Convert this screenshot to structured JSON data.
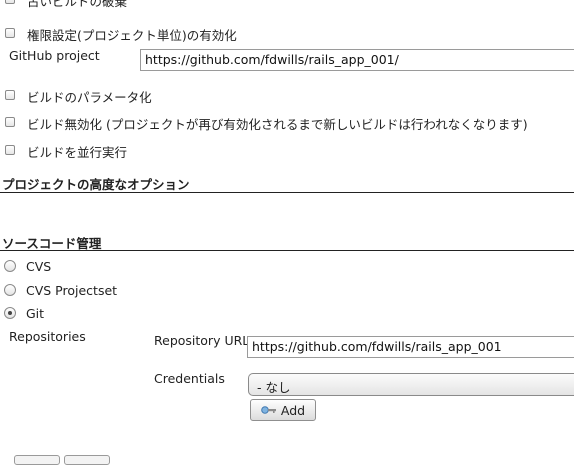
{
  "options": {
    "discard_old_builds": "古いビルドの破棄",
    "enable_project_security": "権限設定(プロジェクト単位)の有効化",
    "github_project_label": "GitHub project",
    "github_project_value": "https://github.com/fdwills/rails_app_001/",
    "parameterized": "ビルドのパラメータ化",
    "disable_build": "ビルド無効化 (プロジェクトが再び有効化されるまで新しいビルドは行われなくなります)",
    "concurrent_build": "ビルドを並行実行"
  },
  "advanced_section_title": "プロジェクトの高度なオプション",
  "scm": {
    "title": "ソースコード管理",
    "options": [
      "CVS",
      "CVS Projectset",
      "Git"
    ],
    "selected": "Git",
    "repositories_label": "Repositories",
    "repository_url_label": "Repository URL",
    "repository_url_value": "https://github.com/fdwills/rails_app_001",
    "credentials_label": "Credentials",
    "credentials_value": "- なし",
    "add_button": "Add"
  }
}
